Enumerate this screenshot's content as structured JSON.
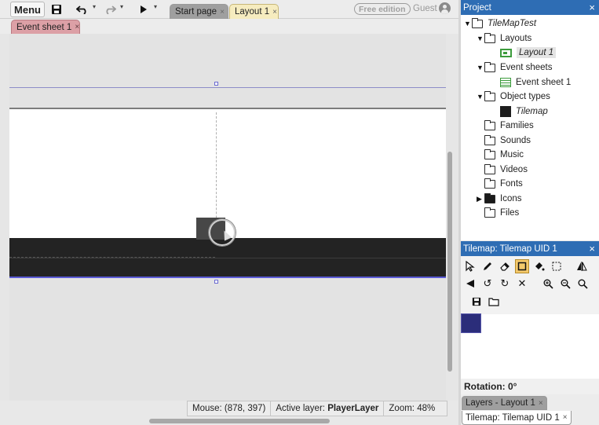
{
  "toolbar": {
    "menu_label": "Menu",
    "icons": [
      "save-icon",
      "undo-icon",
      "redo-icon",
      "play-icon"
    ],
    "tabs": [
      {
        "label": "Start page",
        "close": "×"
      },
      {
        "label": "Layout 1",
        "close": "×"
      }
    ],
    "free_edition": "Free edition",
    "guest": "Guest"
  },
  "subtabs": [
    {
      "label": "Event sheet 1",
      "close": "×"
    }
  ],
  "status": {
    "mouse": "Mouse: (878, 397)",
    "active_layer_label": "Active layer:",
    "active_layer_value": "PlayerLayer",
    "zoom": "Zoom: 48%"
  },
  "project": {
    "title": "Project",
    "close": "×",
    "root": "TileMapTest",
    "items": [
      {
        "label": "Layouts"
      },
      {
        "label": "Layout 1"
      },
      {
        "label": "Event sheets"
      },
      {
        "label": "Event sheet 1"
      },
      {
        "label": "Object types"
      },
      {
        "label": "Tilemap"
      },
      {
        "label": "Families"
      },
      {
        "label": "Sounds"
      },
      {
        "label": "Music"
      },
      {
        "label": "Videos"
      },
      {
        "label": "Fonts"
      },
      {
        "label": "Icons"
      },
      {
        "label": "Files"
      }
    ]
  },
  "tilemap_panel": {
    "title": "Tilemap: Tilemap UID 1",
    "close": "×",
    "rotation_label": "Rotation: 0°",
    "tools": [
      "select-icon",
      "pencil-icon",
      "eraser-icon",
      "rectangle-icon",
      "fill-icon",
      "marquee-icon",
      "flip-horizontal-icon",
      "flip-vertical-icon",
      "rotate-ccw-icon",
      "rotate-cw-icon",
      "clear-icon",
      "zoom-in-icon",
      "zoom-out-icon",
      "zoom-reset-icon",
      "save-icon",
      "folder-icon"
    ]
  },
  "bottom_tabs": [
    {
      "label": "Layers - Layout 1",
      "close": "×"
    },
    {
      "label": "Tilemap: Tilemap UID 1",
      "close": "×"
    }
  ],
  "colors": {
    "panel_header": "#2e6db4",
    "active_tab": "#f6ecbf",
    "event_tab": "#dca0a6",
    "layout_icon": "#3c9b3c",
    "tool_active": "#f4c96b"
  }
}
